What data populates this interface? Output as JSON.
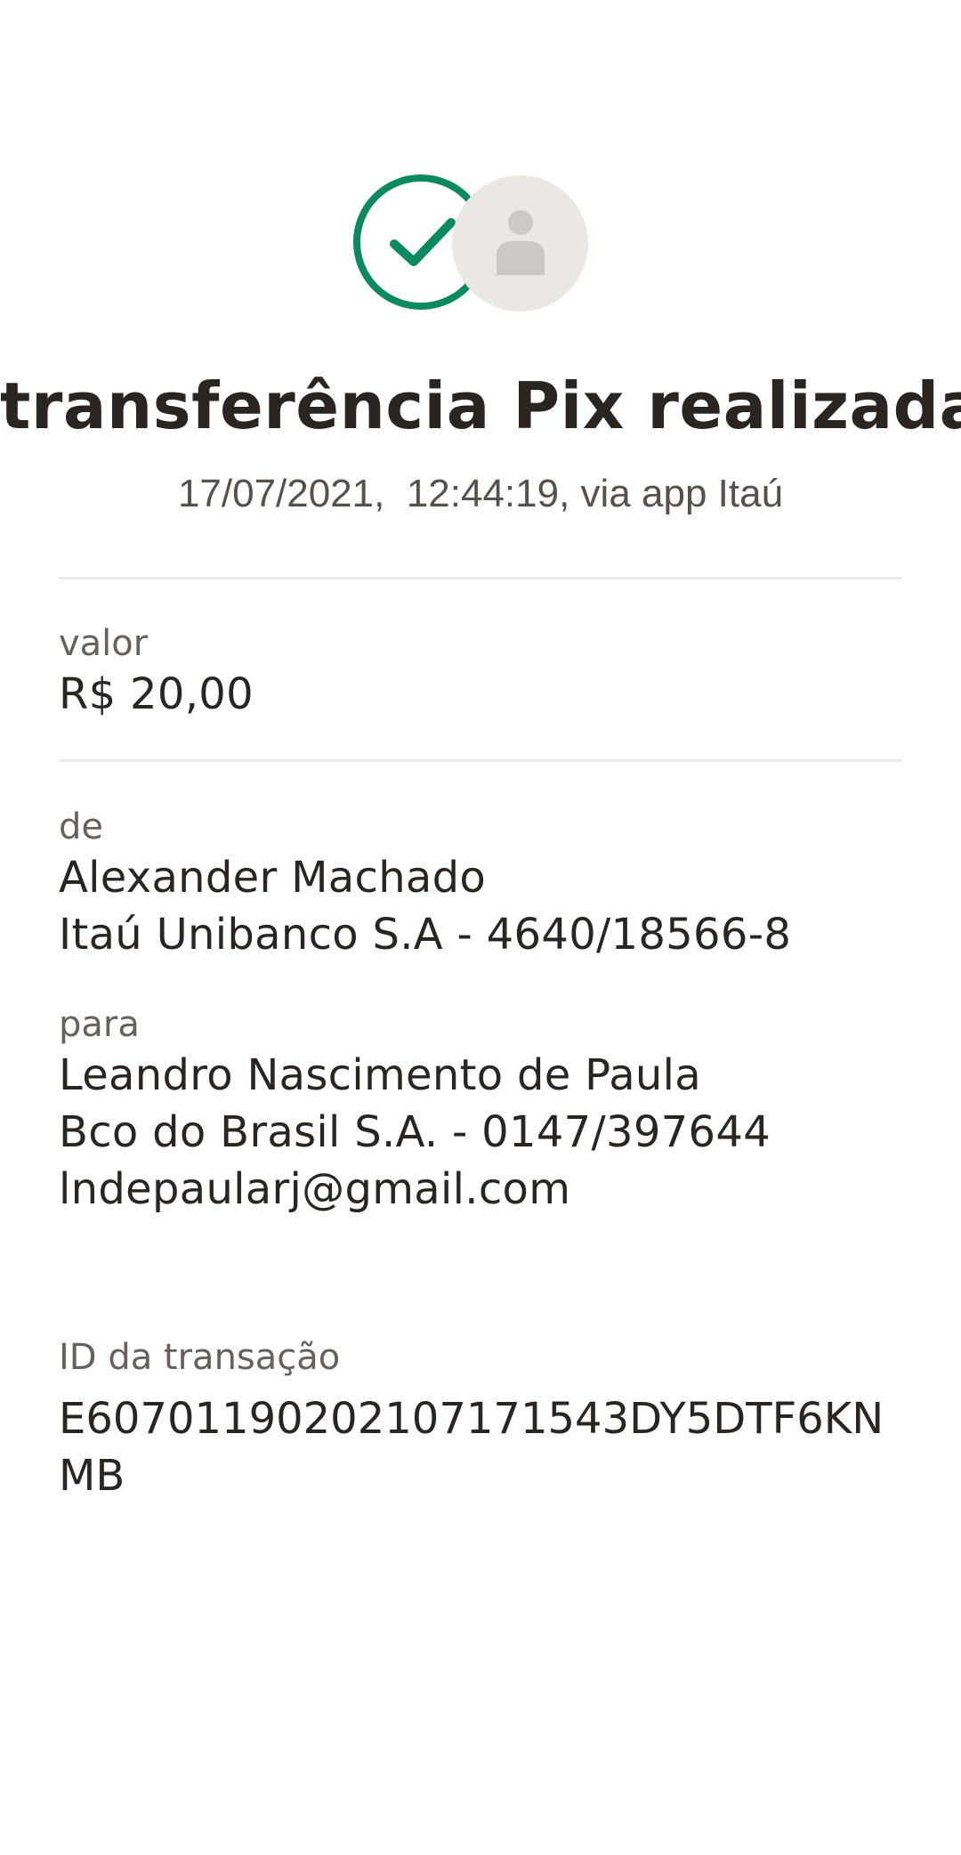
{
  "colors": {
    "success": "#0a8a5f",
    "avatar_bg": "#ebe7e3",
    "text_primary": "#2b2522",
    "text_secondary": "#67605b",
    "divider": "#ece9e6"
  },
  "icons": {
    "status": "check-circle-icon",
    "recipient": "person-avatar-icon"
  },
  "header": {
    "title": "transferência Pix realizada",
    "subtitle": "17/07/2021,  12:44:19, via app Itaú"
  },
  "amount": {
    "label": "valor",
    "value": "R$ 20,00"
  },
  "from": {
    "label": "de",
    "name": "Alexander Machado",
    "account": "Itaú Unibanco S.A - 4640/18566-8"
  },
  "to": {
    "label": "para",
    "name": "Leandro Nascimento de Paula",
    "account": "Bco do Brasil S.A. - 0147/397644",
    "key": "lndepaularj@gmail.com"
  },
  "transaction": {
    "label": "ID da transação",
    "id": "E60701190202107171543DY5DTF6KNMB"
  }
}
